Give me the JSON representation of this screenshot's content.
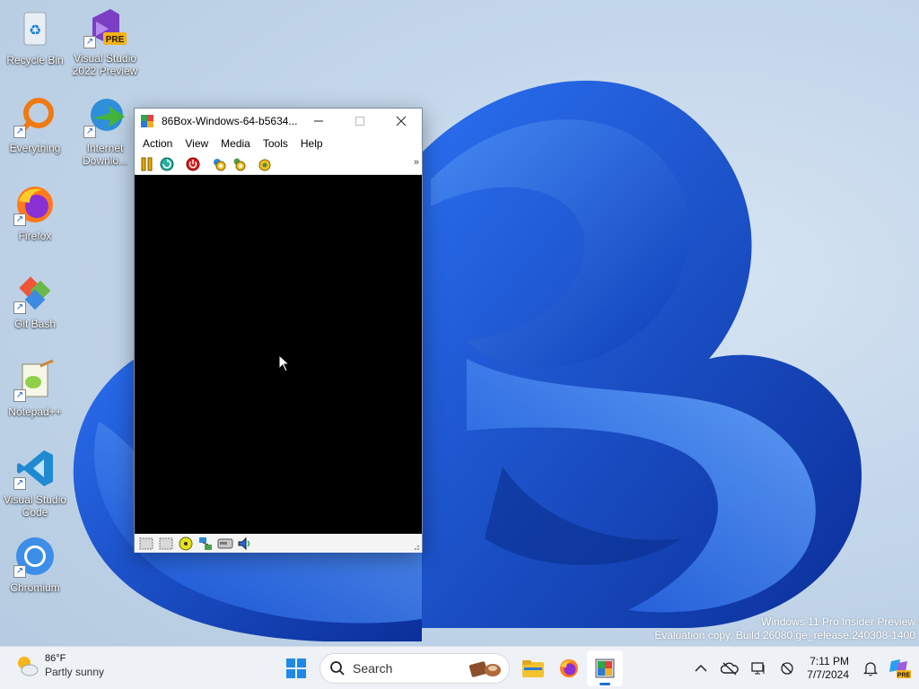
{
  "desktop": {
    "icons": [
      {
        "label": "Recycle Bin",
        "icon": "recycle-bin-icon"
      },
      {
        "label": "Visual Studio 2022 Preview",
        "icon": "visual-studio-preview-icon",
        "badge": "PRE"
      },
      {
        "label": "Everything",
        "icon": "everything-search-icon"
      },
      {
        "label": "Internet Downlo...",
        "icon": "internet-download-manager-icon"
      },
      {
        "label": "Firefox",
        "icon": "firefox-icon"
      },
      {
        "label": "Git Bash",
        "icon": "git-bash-icon"
      },
      {
        "label": "Notepad++",
        "icon": "notepad-plus-plus-icon"
      },
      {
        "label": "Visual Studio Code",
        "icon": "vscode-icon"
      },
      {
        "label": "Chromium",
        "icon": "chromium-icon"
      }
    ]
  },
  "app_window": {
    "title": "86Box-Windows-64-b5634...",
    "menu": [
      "Action",
      "View",
      "Media",
      "Tools",
      "Help"
    ],
    "toolbar": {
      "buttons": [
        "pause-icon",
        "reset-icon",
        "power-icon",
        "settings-icon",
        "media-settings-icon",
        "screenshot-icon"
      ],
      "overflow_label": "»"
    },
    "status_icons": [
      "floppy-drive-icon",
      "floppy-drive-icon",
      "cdrom-icon",
      "network-icon",
      "hard-disk-icon",
      "sound-icon"
    ]
  },
  "watermark": {
    "line1": "Windows 11 Pro Insider Preview",
    "line2": "Evaluation copy. Build 26080.ge_release.240308-1400"
  },
  "taskbar": {
    "weather": {
      "temp": "86°F",
      "condition": "Partly sunny",
      "icon": "partly-sunny-icon"
    },
    "search_placeholder": "Search",
    "pinned": [
      "start-icon",
      "search-icon",
      "file-explorer-icon",
      "firefox-icon",
      "86box-icon"
    ],
    "tray_icons": [
      "chevron-up-icon",
      "onedrive-offline-icon",
      "display-icon",
      "network-offline-icon"
    ],
    "time": "7:11 PM",
    "date": "7/7/2024",
    "colors": {
      "accent": "#1f6fd1"
    }
  }
}
